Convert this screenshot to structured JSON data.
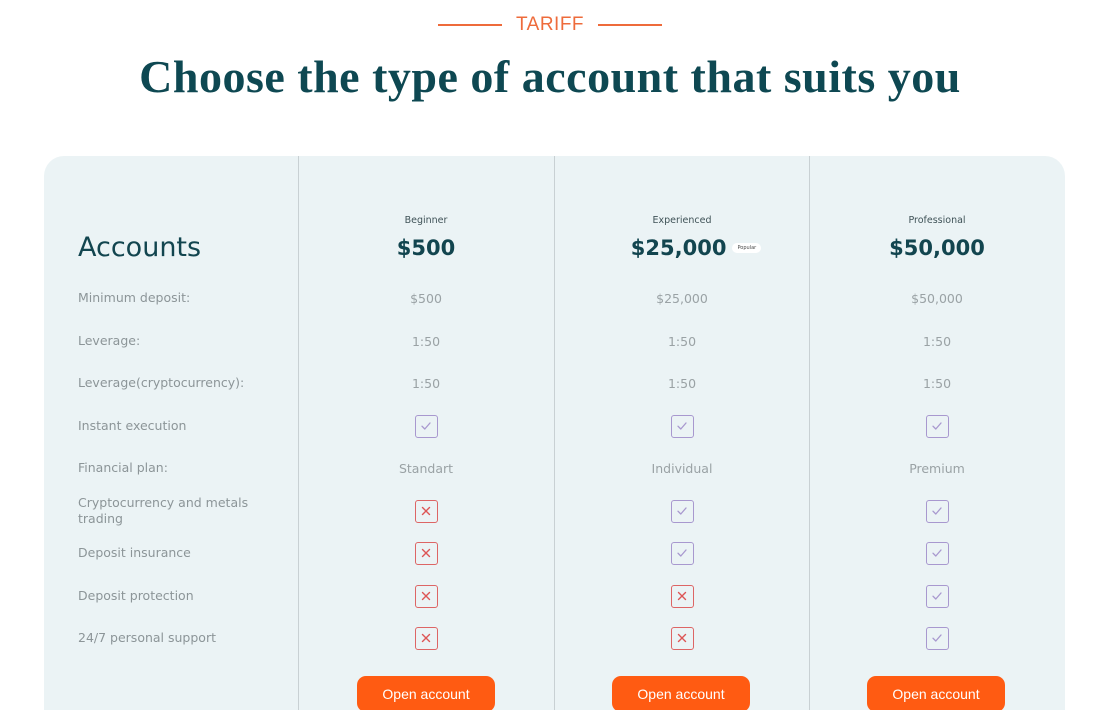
{
  "header": {
    "eyebrow": "TARIFF",
    "title": "Choose the type of account that suits you"
  },
  "table": {
    "title": "Accounts",
    "plans": [
      {
        "tier": "Beginner",
        "price": "$500",
        "badge": null,
        "button_label": "Open account"
      },
      {
        "tier": "Experienced",
        "price": "$25,000",
        "badge": "Popular",
        "button_label": "Open account"
      },
      {
        "tier": "Professional",
        "price": "$50,000",
        "badge": null,
        "button_label": "Open account"
      }
    ],
    "rows": [
      {
        "label": "Minimum deposit:",
        "type": "text",
        "values": [
          "$500",
          "$25,000",
          "$50,000"
        ]
      },
      {
        "label": "Leverage:",
        "type": "text",
        "values": [
          "1:50",
          "1:50",
          "1:50"
        ]
      },
      {
        "label": "Leverage(cryptocurrency):",
        "type": "text",
        "values": [
          "1:50",
          "1:50",
          "1:50"
        ]
      },
      {
        "label": "Instant execution",
        "type": "bool",
        "values": [
          true,
          true,
          true
        ]
      },
      {
        "label": "Financial plan:",
        "type": "text",
        "values": [
          "Standart",
          "Individual",
          "Premium"
        ]
      },
      {
        "label": "Cryptocurrency and metals trading",
        "type": "bool",
        "values": [
          false,
          true,
          true
        ]
      },
      {
        "label": "Deposit insurance",
        "type": "bool",
        "values": [
          false,
          true,
          true
        ]
      },
      {
        "label": "Deposit protection",
        "type": "bool",
        "values": [
          false,
          false,
          true
        ]
      },
      {
        "label": "24/7 personal support",
        "type": "bool",
        "values": [
          false,
          false,
          true
        ]
      }
    ]
  },
  "colors": {
    "accent": "#ff5b12",
    "eyebrow": "#ee6b3b",
    "heading": "#0e4852",
    "card_bg": "#ebf3f5",
    "check": "#a898cf",
    "cross": "#dd6565"
  }
}
